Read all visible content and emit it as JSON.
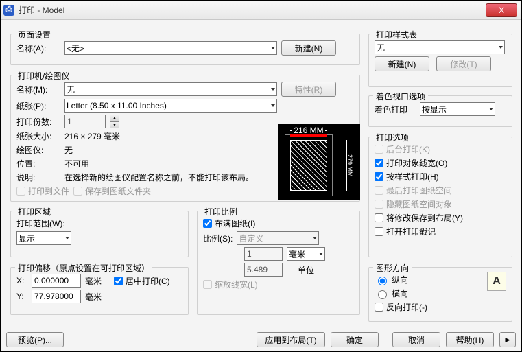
{
  "window": {
    "title": "打印 - Model",
    "close_x": "X"
  },
  "pageSetup": {
    "legend": "页面设置",
    "name_label": "名称(A):",
    "name_value": "<无>",
    "new_btn": "新建(N)"
  },
  "printer": {
    "legend": "打印机/绘图仪",
    "name_label": "名称(M):",
    "name_value": "无",
    "props_btn": "特性(R)",
    "paper_label": "纸张(P):",
    "paper_value": "Letter (8.50 x 11.00 Inches)",
    "copies_label": "打印份数:",
    "copies_value": "1",
    "papersize_label": "纸张大小:",
    "papersize_value": "216 × 279  毫米",
    "plotter_label": "绘图仪:",
    "plotter_value": "无",
    "location_label": "位置:",
    "location_value": "不可用",
    "desc_label": "说明:",
    "desc_value": "在选择新的绘图仪配置名称之前，不能打印该布局。",
    "print_to_file": "打印到文件",
    "save_to_paper": "保存到图纸文件夹",
    "preview_w": "216 MM",
    "preview_h": "279 MM"
  },
  "area": {
    "legend": "打印区域",
    "range_label": "打印范围(W):",
    "range_value": "显示"
  },
  "offset": {
    "legend": "打印偏移（原点设置在可打印区域）",
    "x_label": "X:",
    "x_value": "0.000000",
    "x_unit": "毫米",
    "y_label": "Y:",
    "y_value": "77.978000",
    "y_unit": "毫米",
    "center": "居中打印(C)"
  },
  "scale": {
    "legend": "打印比例",
    "fit": "布满图纸(I)",
    "ratio_label": "比例(S):",
    "ratio_value": "自定义",
    "num": "1",
    "unit_sel": "毫米",
    "equals": "=",
    "den": "5.489",
    "unit_lbl": "单位",
    "scalelw": "缩放线宽(L)"
  },
  "styleTable": {
    "legend": "打印样式表",
    "value": "无",
    "new_btn": "新建(N)",
    "edit_btn": "修改(T)"
  },
  "viewport": {
    "legend": "着色视口选项",
    "shade_label": "着色打印",
    "shade_value": "按显示"
  },
  "options": {
    "legend": "打印选项",
    "bg": "后台打印(K)",
    "lw": "打印对象线宽(O)",
    "style": "按样式打印(H)",
    "last": "最后打印图纸空间",
    "hide": "隐藏图纸空间对象",
    "savechg": "将修改保存到布局(Y)",
    "stamp": "打开打印戳记"
  },
  "orient": {
    "legend": "图形方向",
    "portrait": "纵向",
    "landscape": "横向",
    "upside": "反向打印(-)",
    "icon": "A"
  },
  "bottom": {
    "preview": "预览(P)...",
    "apply": "应用到布局(T)",
    "ok": "确定",
    "cancel": "取消",
    "help": "帮助(H)",
    "expand": "►"
  }
}
